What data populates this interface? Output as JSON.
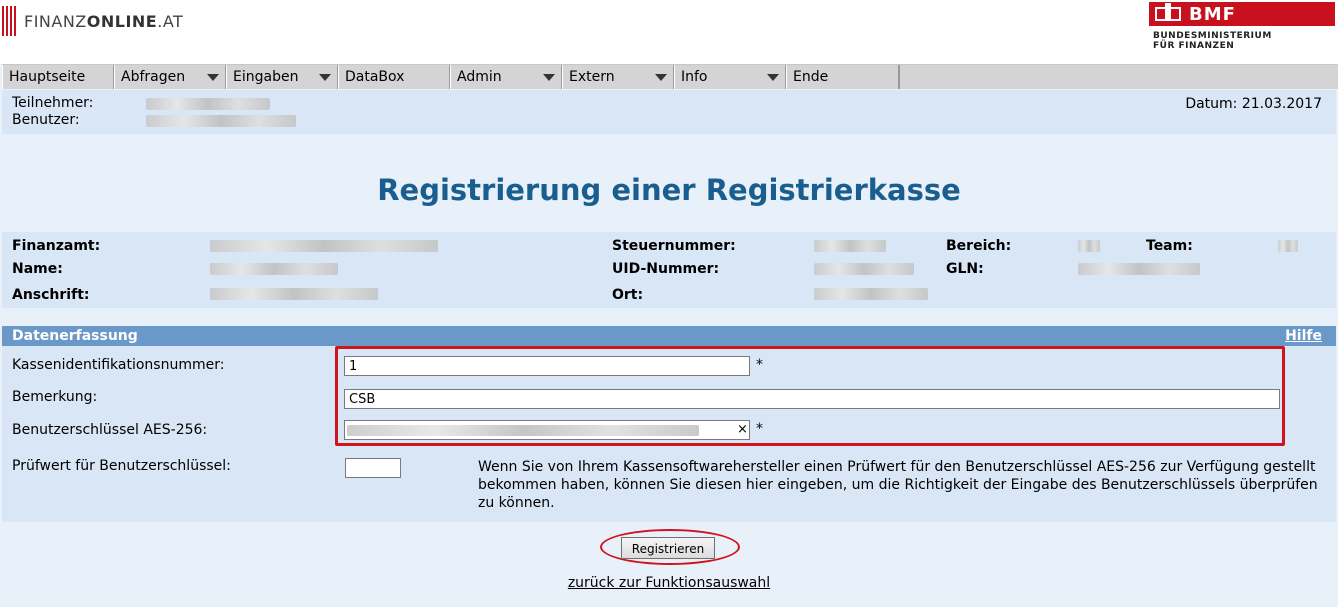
{
  "header": {
    "logo_left": "FINANZ",
    "logo_bold": "ONLINE",
    "logo_tld": ".AT",
    "bmf_title": "BMF",
    "bmf_sub1": "BUNDESMINISTERIUM",
    "bmf_sub2": "FÜR FINANZEN"
  },
  "menu": {
    "items": [
      {
        "label": "Hauptseite",
        "dropdown": false
      },
      {
        "label": "Abfragen",
        "dropdown": true
      },
      {
        "label": "Eingaben",
        "dropdown": true
      },
      {
        "label": "DataBox",
        "dropdown": false
      },
      {
        "label": "Admin",
        "dropdown": true
      },
      {
        "label": "Extern",
        "dropdown": true
      },
      {
        "label": "Info",
        "dropdown": true
      },
      {
        "label": "Ende",
        "dropdown": false
      }
    ]
  },
  "userbar": {
    "teilnehmer_label": "Teilnehmer:",
    "benutzer_label": "Benutzer:",
    "datum": "Datum: 21.03.2017"
  },
  "page_title": "Registrierung einer Registrierkasse",
  "info": {
    "finanzamt_label": "Finanzamt:",
    "name_label": "Name:",
    "anschrift_label": "Anschrift:",
    "steuernummer_label": "Steuernummer:",
    "uid_label": "UID-Nummer:",
    "ort_label": "Ort:",
    "bereich_label": "Bereich:",
    "team_label": "Team:",
    "gln_label": "GLN:"
  },
  "form": {
    "section_title": "Datenerfassung",
    "help_link": "Hilfe",
    "kassen_id_label": "Kassenidentifikationsnummer:",
    "kassen_id_value": "1",
    "bemerkung_label": "Bemerkung:",
    "bemerkung_value": "CSB",
    "aes_label": "Benutzerschlüssel AES-256:",
    "aes_clear": "×",
    "pruefwert_label": "Prüfwert für Benutzerschlüssel:",
    "pruefwert_value": "",
    "required_mark": "*",
    "hint": "Wenn Sie von Ihrem Kassensoftwarehersteller einen Prüfwert für den Benutzerschlüssel AES-256 zur Verfügung gestellt bekommen haben, können Sie diesen hier eingeben, um die Richtigkeit der Eingabe des Benutzerschlüssels überprüfen zu können.",
    "submit_label": "Registrieren"
  },
  "back_link": "zurück zur Funktionsauswahl",
  "colors": {
    "brand_red": "#c8101e",
    "title_blue": "#1a5e8f",
    "section_blue": "#6a98c8",
    "panel_blue": "#d9e6f5"
  }
}
